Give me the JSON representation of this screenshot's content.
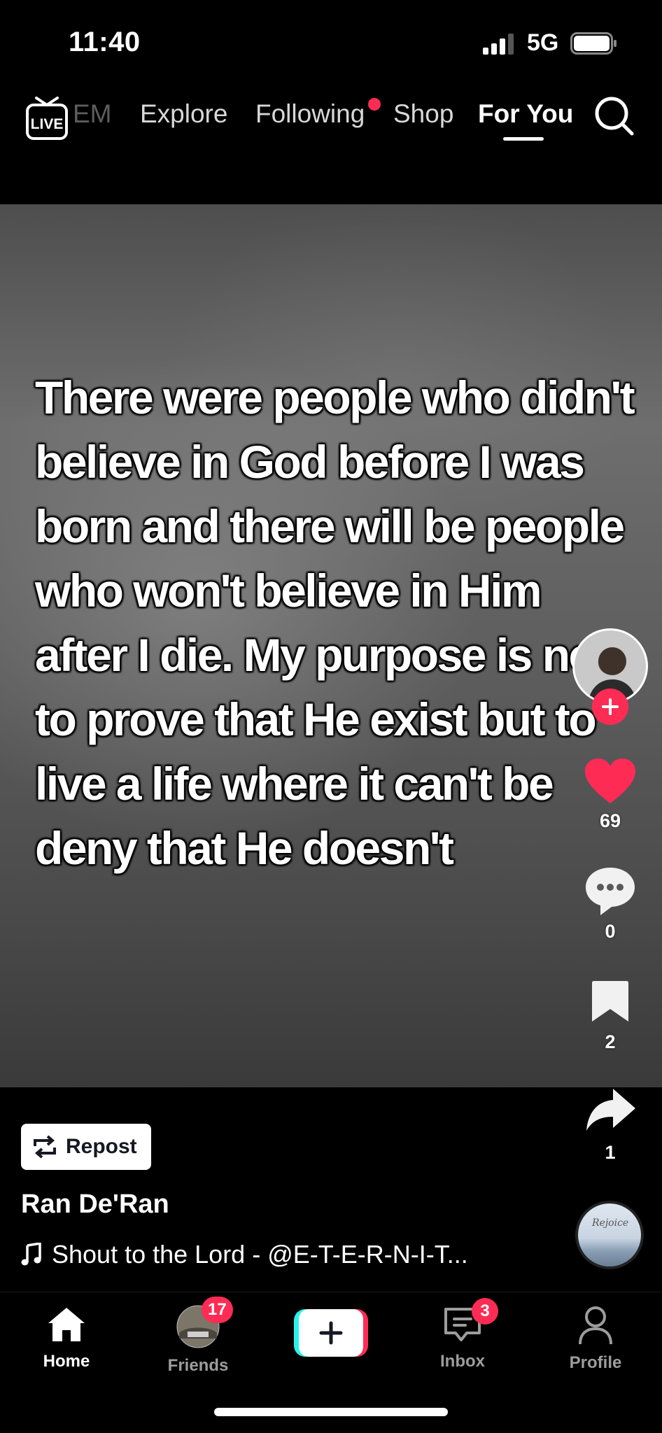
{
  "status_bar": {
    "time": "11:40",
    "network": "5G"
  },
  "top_nav": {
    "tabs": [
      {
        "label": "EM"
      },
      {
        "label": "Explore"
      },
      {
        "label": "Following"
      },
      {
        "label": "Shop"
      },
      {
        "label": "For You"
      }
    ],
    "active_tab": "For You"
  },
  "video": {
    "overlay_text": "There were people who didn't believe in God before I was born and there will be people who won't believe in Him after I die. My purpose is not to prove that He exist but to live a life where it can't be deny that He doesn't"
  },
  "actions": {
    "likes": "69",
    "comments": "0",
    "saves": "2",
    "shares": "1"
  },
  "caption": {
    "repost_label": "Repost",
    "author": "Ran De'Ran",
    "music": "Shout to the Lord - @E-T-E-R-N-I-T...",
    "disc_text": "Rejoice"
  },
  "tab_bar": {
    "home": "Home",
    "friends": "Friends",
    "friends_badge": "17",
    "inbox": "Inbox",
    "inbox_badge": "3",
    "profile": "Profile"
  },
  "colors": {
    "accent": "#fe2c55",
    "cyan": "#25f4ee",
    "background": "#000000"
  }
}
